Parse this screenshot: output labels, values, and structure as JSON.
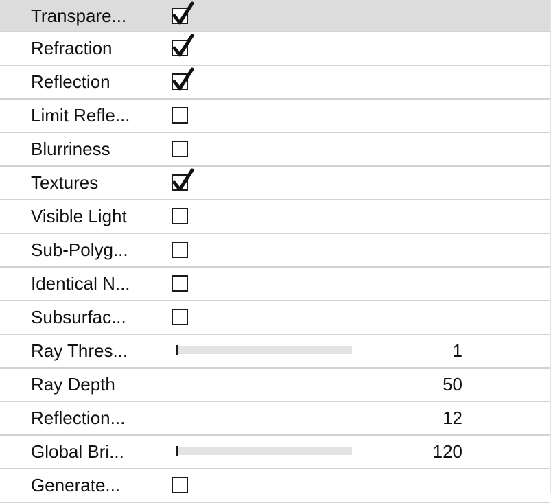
{
  "rows": [
    {
      "label": "Transpare...",
      "type": "checkbox",
      "checked": true,
      "highlight": true
    },
    {
      "label": "Refraction",
      "type": "checkbox",
      "checked": true
    },
    {
      "label": "Reflection",
      "type": "checkbox",
      "checked": true
    },
    {
      "label": "Limit Refle...",
      "type": "checkbox",
      "checked": false
    },
    {
      "label": "Blurriness",
      "type": "checkbox",
      "checked": false
    },
    {
      "label": "Textures",
      "type": "checkbox",
      "checked": true
    },
    {
      "label": "Visible Light",
      "type": "checkbox",
      "checked": false
    },
    {
      "label": "Sub-Polyg...",
      "type": "checkbox",
      "checked": false
    },
    {
      "label": "Identical N...",
      "type": "checkbox",
      "checked": false
    },
    {
      "label": "Subsurfac...",
      "type": "checkbox",
      "checked": false
    },
    {
      "label": "Ray Thres...",
      "type": "slider",
      "value": "1"
    },
    {
      "label": "Ray Depth",
      "type": "number",
      "value": "50"
    },
    {
      "label": "Reflection...",
      "type": "number",
      "value": "12"
    },
    {
      "label": "Global Bri...",
      "type": "slider",
      "value": "120"
    },
    {
      "label": "Generate...",
      "type": "checkbox",
      "checked": false
    }
  ],
  "colors": {
    "highlight": "#dcdcdc",
    "separator": "#d2d2d2",
    "track": "#e3e3e3"
  }
}
